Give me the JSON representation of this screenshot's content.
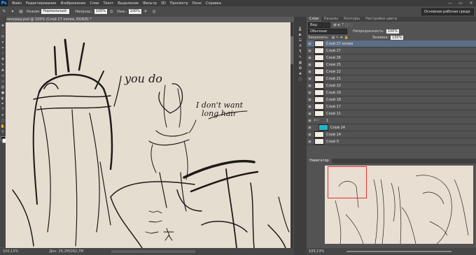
{
  "menubar": {
    "logo": "Ps",
    "items": [
      "Файл",
      "Редактирование",
      "Изображение",
      "Слои",
      "Текст",
      "Выделение",
      "Фильтр",
      "3D",
      "Просмотр",
      "Окно",
      "Справка"
    ],
    "window_controls": [
      "—",
      "▭",
      "✕"
    ]
  },
  "options": {
    "mode_label": "Режим:",
    "mode_value": "Нормальный",
    "opacity_label": "Непрозр.:",
    "opacity_value": "100%",
    "flow_label": "Наж.:",
    "flow_value": "100%"
  },
  "workspace": {
    "label": "Основная рабочая среда"
  },
  "document": {
    "tab_title": "нинсред.psd @ 100% (Слой 27 копия, RGB/8) *"
  },
  "canvas": {
    "bg_color": "#e6ddd1",
    "text_you_do": "you do",
    "text_line1": "I don't want",
    "text_line2": "long hair"
  },
  "status": {
    "zoom": "100,13%",
    "doc": "Док: 26,2M/262,7M"
  },
  "layers_panel": {
    "tabs": [
      "Слои",
      "Каналы",
      "Контуры",
      "Настройки цвета"
    ],
    "kind_label": "Вид",
    "blend_mode": "Обычные",
    "opacity_label": "Непрозрачность:",
    "opacity_value": "100%",
    "lock_label": "Закрепить:",
    "fill_label": "Заливка:",
    "fill_value": "100%",
    "items": [
      {
        "name": "Слой 27 копия",
        "selected": true
      },
      {
        "name": "Слой 27"
      },
      {
        "name": "Слой 26"
      },
      {
        "name": "Слой 25"
      },
      {
        "name": "Слой 22"
      },
      {
        "name": "Слой 21"
      },
      {
        "name": "Слой 22"
      },
      {
        "name": "Слой 19"
      },
      {
        "name": "Слой 18"
      },
      {
        "name": "Слой 17"
      },
      {
        "name": "Слой 11"
      },
      {
        "name": "1"
      },
      {
        "name": "Слой 24"
      },
      {
        "name": "Слой 14"
      },
      {
        "name": "Слой 0"
      }
    ]
  },
  "navigator": {
    "tab": "Навигатор",
    "zoom": "100,13%"
  }
}
